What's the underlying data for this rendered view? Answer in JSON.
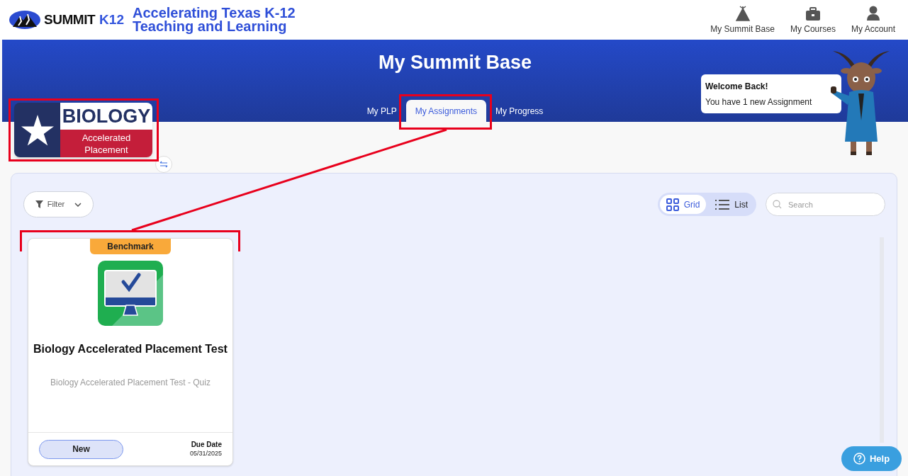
{
  "header": {
    "logo_text": "SUMMIT",
    "logo_accent": "K12",
    "tagline_lines": [
      "Accelerating Texas K-12",
      "Teaching and Learning"
    ],
    "nav": [
      {
        "label": "My Summit Base"
      },
      {
        "label": "My Courses"
      },
      {
        "label": "My Account"
      }
    ]
  },
  "banner": {
    "title": "My Summit Base",
    "tabs": [
      {
        "label": "My PLP",
        "selected": false
      },
      {
        "label": "My Assignments",
        "selected": true
      },
      {
        "label": "My Progress",
        "selected": false
      }
    ]
  },
  "welcome": {
    "title": "Welcome Back!",
    "message": "You have 1 new Assignment"
  },
  "course_badge": {
    "title": "BIOLOGY",
    "subtitle_lines": [
      "Accelerated",
      "Placement"
    ]
  },
  "toolbar": {
    "filter": "Filter",
    "views": [
      {
        "label": "Grid",
        "selected": true
      },
      {
        "label": "List",
        "selected": false
      }
    ],
    "search": {
      "placeholder": "Search"
    }
  },
  "assignments": [
    {
      "tag": "Benchmark",
      "title": "Biology Accelerated Placement Test",
      "subtitle": "Biology Accelerated Placement Test - Quiz",
      "status": "New",
      "due_label": "Due Date",
      "due_date": "05/31/2025"
    }
  ],
  "help_button": "Help"
}
